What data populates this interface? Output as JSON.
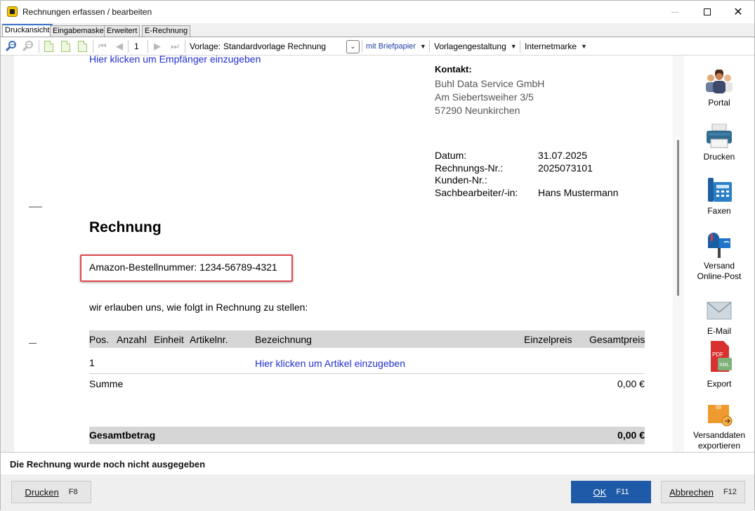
{
  "window": {
    "title": "Rechnungen erfassen / bearbeiten"
  },
  "tabs": [
    {
      "label": "Druckansicht",
      "active": true
    },
    {
      "label": "Eingabemaske",
      "active": false
    },
    {
      "label": "Erweitert",
      "active": false
    },
    {
      "label": "E-Rechnung",
      "active": false
    }
  ],
  "toolbar": {
    "page_number": "1",
    "template_label": "Vorlage:",
    "template_value": "Standardvorlage Rechnung",
    "letterhead": "mit Briefpapier",
    "design": "Vorlagengestaltung",
    "stamp": "Internetmarke"
  },
  "document": {
    "recipient_link": "Hier klicken um Empfänger einzugeben",
    "contact_heading": "Kontakt:",
    "contact_lines": [
      "Buhl Data Service GmbH",
      "Am Siebertsweiher 3/5",
      "57290 Neunkirchen"
    ],
    "meta": [
      {
        "label": "Datum:",
        "value": "31.07.2025"
      },
      {
        "label": "Rechnungs-Nr.:",
        "value": "2025073101"
      },
      {
        "label": "Kunden-Nr.:",
        "value": ""
      },
      {
        "label": "Sachbearbeiter/-in:",
        "value": "Hans Mustermann"
      }
    ],
    "heading": "Rechnung",
    "order_number": "Amazon-Bestellnummer: 1234-56789-4321",
    "intro": "wir erlauben uns, wie folgt in Rechnung zu stellen:",
    "columns": [
      "Pos.",
      "Anzahl",
      "Einheit",
      "Artikelnr.",
      "Bezeichnung",
      "Einzelpreis",
      "Gesamtpreis"
    ],
    "row": {
      "pos": "1",
      "article_link": "Hier klicken um Artikel einzugeben"
    },
    "sum_label": "Summe",
    "sum_value": "0,00 €",
    "total_label": "Gesamtbetrag",
    "total_value": "0,00 €"
  },
  "sidebar": {
    "items": [
      {
        "label": "Portal",
        "icon": "people-icon"
      },
      {
        "label": "Drucken",
        "icon": "printer-icon"
      },
      {
        "label": "Faxen",
        "icon": "fax-icon"
      },
      {
        "label": "Versand Online-Post",
        "icon": "mailbox-icon"
      },
      {
        "label": "E-Mail",
        "icon": "envelope-icon"
      },
      {
        "label": "Export",
        "icon": "pdf-xml-icon"
      },
      {
        "label": "Versanddaten exportieren",
        "icon": "package-icon"
      }
    ]
  },
  "status": {
    "message": "Die Rechnung wurde noch nicht ausgegeben"
  },
  "footer": {
    "print": {
      "label": "Drucken",
      "key": "F8"
    },
    "ok": {
      "label": "OK",
      "key": "F11"
    },
    "cancel": {
      "label": "Abbrechen",
      "key": "F12"
    }
  },
  "colors": {
    "accent": "#1e5aa8",
    "link": "#1f2fd0",
    "highlight": "#e0474f"
  }
}
